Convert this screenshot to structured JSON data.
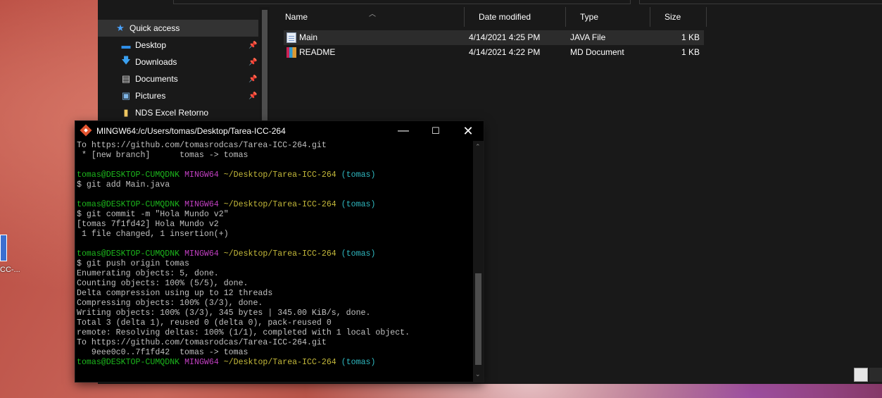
{
  "desktop": {
    "icon_label": "CC-..."
  },
  "explorer": {
    "nav": [
      {
        "label": "Quick access",
        "icon": "star-icon",
        "pinned": false
      },
      {
        "label": "Desktop",
        "icon": "desktop-icon",
        "pinned": true
      },
      {
        "label": "Downloads",
        "icon": "download-arrow-icon",
        "pinned": true
      },
      {
        "label": "Documents",
        "icon": "documents-icon",
        "pinned": true
      },
      {
        "label": "Pictures",
        "icon": "pictures-icon",
        "pinned": true
      },
      {
        "label": "NDS Excel Retorno",
        "icon": "folder-icon",
        "pinned": false
      }
    ],
    "columns": [
      "Name",
      "Date modified",
      "Type",
      "Size"
    ],
    "files": [
      {
        "name": "Main",
        "date": "4/14/2021 4:25 PM",
        "type": "JAVA File",
        "size": "1 KB",
        "icon": "java-file-icon"
      },
      {
        "name": "README",
        "date": "4/14/2021 4:22 PM",
        "type": "MD Document",
        "size": "1 KB",
        "icon": "md-file-icon"
      }
    ]
  },
  "terminal": {
    "title": "MINGW64:/c/Users/tomas/Desktop/Tarea-ICC-264",
    "prompt": {
      "user": "tomas@DESKTOP-CUMQDNK",
      "env": "MINGW64",
      "path": "~/Desktop/Tarea-ICC-264",
      "branch": "(tomas)"
    },
    "lines": [
      "To https://github.com/tomasrodcas/Tarea-ICC-264.git",
      " * [new branch]      tomas -> tomas",
      "",
      "$ git add Main.java",
      "",
      "$ git commit -m \"Hola Mundo v2\"",
      "[tomas 7f1fd42] Hola Mundo v2",
      " 1 file changed, 1 insertion(+)",
      "",
      "$ git push origin tomas",
      "Enumerating objects: 5, done.",
      "Counting objects: 100% (5/5), done.",
      "Delta compression using up to 12 threads",
      "Compressing objects: 100% (3/3), done.",
      "Writing objects: 100% (3/3), 345 bytes | 345.00 KiB/s, done.",
      "Total 3 (delta 1), reused 0 (delta 0), pack-reused 0",
      "remote: Resolving deltas: 100% (1/1), completed with 1 local object.",
      "To https://github.com/tomasrodcas/Tarea-ICC-264.git",
      "   9eee0c0..7f1fd42  tomas -> tomas",
      ""
    ],
    "prompt_before_line_indices": [
      3,
      5,
      9,
      19
    ]
  }
}
